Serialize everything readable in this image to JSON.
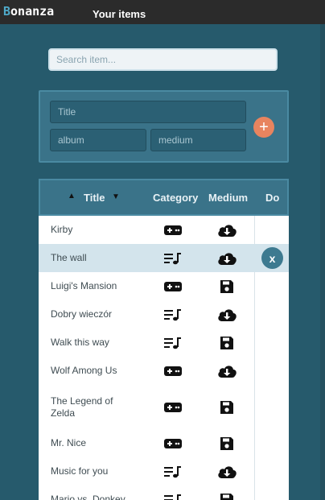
{
  "header": {
    "brand_first": "B",
    "brand_rest": "onanza",
    "nav_label": "Your items"
  },
  "search": {
    "placeholder": "Search item..."
  },
  "add_form": {
    "title_placeholder": "Title",
    "album_placeholder": "album",
    "medium_placeholder": "medium",
    "add_label": "+"
  },
  "table": {
    "columns": {
      "title": "Title",
      "category": "Category",
      "medium": "Medium",
      "do": "Do"
    },
    "sort_up": "▲",
    "sort_down": "▼",
    "delete_label": "x",
    "rows": [
      {
        "title": "Kirby",
        "category": "game",
        "medium": "cloud"
      },
      {
        "title": "The wall",
        "category": "music",
        "medium": "cloud",
        "selected": true
      },
      {
        "title": "Luigi's Mansion",
        "category": "game",
        "medium": "disk"
      },
      {
        "title": "Dobry wieczór",
        "category": "music",
        "medium": "cloud"
      },
      {
        "title": "Walk this way",
        "category": "music",
        "medium": "disk"
      },
      {
        "title": "Wolf Among Us",
        "category": "game",
        "medium": "cloud"
      },
      {
        "title": "The Legend of Zelda",
        "category": "game",
        "medium": "disk"
      },
      {
        "title": "Mr. Nice",
        "category": "game",
        "medium": "disk"
      },
      {
        "title": "Music for you",
        "category": "music",
        "medium": "cloud"
      },
      {
        "title": "Mario vs. Donkey",
        "category": "music",
        "medium": "disk"
      }
    ]
  },
  "colors": {
    "background": "#265a6c",
    "panel": "#3a7389",
    "accent": "#e8845f",
    "topbar": "#2b2b2b"
  }
}
